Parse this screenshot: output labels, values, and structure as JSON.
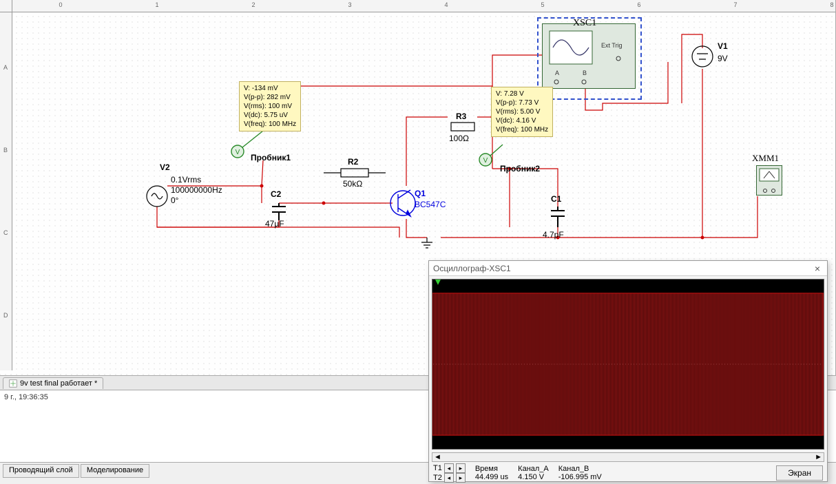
{
  "ruler_top": [
    "0",
    "1",
    "2",
    "3",
    "4",
    "5",
    "6",
    "7",
    "8"
  ],
  "ruler_left": [
    "A",
    "B",
    "C",
    "D"
  ],
  "tab_name": "9v test final работает *",
  "output_timestamp": "9 г., 19:36:35",
  "bottom_tabs": {
    "b": "Проводящий слой",
    "c": "Моделирование"
  },
  "components": {
    "V2": {
      "ref": "V2",
      "l1": "0.1Vrms",
      "l2": "100000000Hz",
      "l3": "0°"
    },
    "C2": {
      "ref": "C2",
      "val": "47µF"
    },
    "R2": {
      "ref": "R2",
      "val": "50kΩ"
    },
    "R3": {
      "ref": "R3",
      "val": "100Ω"
    },
    "Q1": {
      "ref": "Q1",
      "val": "BC547C"
    },
    "C1": {
      "ref": "C1",
      "val": "4.7pF"
    },
    "V1": {
      "ref": "V1",
      "val": "9V"
    },
    "probe1": "Пробник1",
    "probe2": "Пробник2",
    "xsc1": "XSC1",
    "xsc1_a": "A",
    "xsc1_b": "B",
    "xsc1_ext": "Ext Trig",
    "xmm1": "XMM1"
  },
  "probe_tips": {
    "p1": "V: -134 mV\nV(p-p): 282 mV\nV(rms): 100 mV\nV(dc): 5.75 uV\nV(freq): 100 MHz",
    "p2": "V: 7.28 V\nV(p-p): 7.73 V\nV(rms): 5.00 V\nV(dc): 4.16 V\nV(freq): 100 MHz"
  },
  "osc": {
    "title": "Осциллограф-XSC1",
    "cursor_rows": [
      "T1",
      "T2"
    ],
    "cols": {
      "time": "Время",
      "chA": "Канал_А",
      "chB": "Канал_В"
    },
    "t1": {
      "time": "44.499 us",
      "a": "4.150 V",
      "b": "-106.995 mV"
    },
    "screen_btn": "Экран"
  }
}
